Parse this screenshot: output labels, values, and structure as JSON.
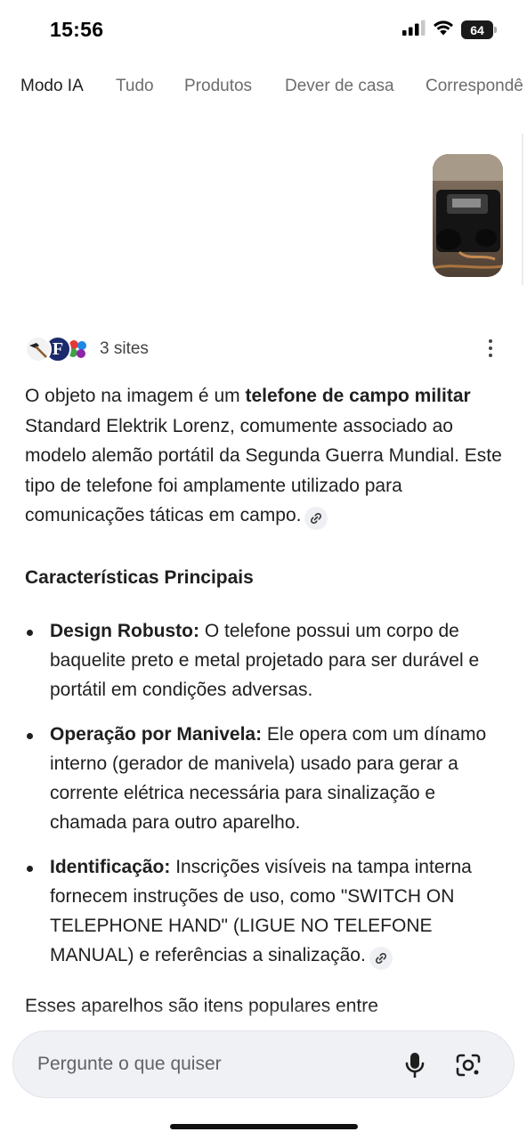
{
  "status_bar": {
    "time": "15:56",
    "battery_level": "64",
    "icons": [
      "signal-icon",
      "wifi-icon",
      "battery-icon"
    ]
  },
  "tabs": [
    {
      "label": "Modo IA",
      "active": true
    },
    {
      "label": "Tudo",
      "active": false
    },
    {
      "label": "Produtos",
      "active": false
    },
    {
      "label": "Dever de casa",
      "active": false
    },
    {
      "label": "Correspondê",
      "active": false
    }
  ],
  "query_image": {
    "icon": "uploaded-photo-thumbnail"
  },
  "sources": {
    "label": "3 sites",
    "favicons": [
      "hammer-favicon",
      "f-favicon",
      "colorful-dots-favicon"
    ]
  },
  "answer": {
    "intro_part1": "O objeto na imagem é um ",
    "intro_bold": "telefone de campo militar",
    "intro_part2": " Standard Elektrik Lorenz, comumente associado ao modelo alemão portátil da Segunda Guerra Mundial. Este tipo de telefone foi amplamente utilizado para comunicações táticas em campo.",
    "section_title": "Características Principais",
    "bullets": [
      {
        "title": "Design Robusto:",
        "text": " O telefone possui um corpo de baquelite preto e metal projetado para ser durável e portátil em condições adversas."
      },
      {
        "title": "Operação por Manivela:",
        "text": " Ele opera com um dínamo interno (gerador de manivela) usado para gerar a corrente elétrica necessária para sinalização e chamada para outro aparelho."
      },
      {
        "title": "Identificação:",
        "text": " Inscrições visíveis na tampa interna fornecem instruções de uso, como \"SWITCH ON TELEPHONE HAND\" (LIGUE NO TELEFONE MANUAL) e referências a sinalização."
      }
    ],
    "trailing": "Esses aparelhos são itens populares entre"
  },
  "input": {
    "placeholder": "Pergunte o que quiser"
  },
  "colors": {
    "text": "#1f1f1f",
    "muted": "#6c6c6c",
    "input_bg": "#eff1f5"
  }
}
